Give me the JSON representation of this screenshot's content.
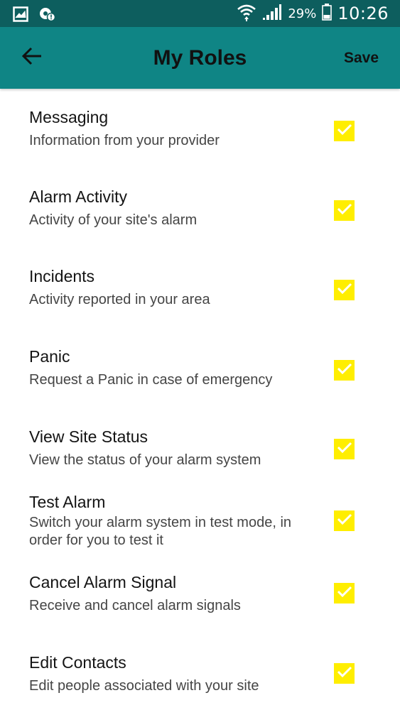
{
  "status_bar": {
    "left_icons": [
      "image-icon",
      "settings-alert-icon"
    ],
    "right_icons": [
      "wifi-icon",
      "cell-signal-icon",
      "battery-icon"
    ],
    "battery": "29%",
    "time": "10:26"
  },
  "app_bar": {
    "back_icon": "arrow-left-icon",
    "title": "My Roles",
    "save_label": "Save",
    "color": "#0f8585"
  },
  "roles": [
    {
      "title": "Messaging",
      "description": "Information from your provider",
      "checked": true
    },
    {
      "title": "Alarm Activity",
      "description": "Activity of your site's alarm",
      "checked": true
    },
    {
      "title": "Incidents",
      "description": "Activity reported in your area",
      "checked": true
    },
    {
      "title": "Panic",
      "description": "Request a Panic in case of emergency",
      "checked": true
    },
    {
      "title": "View Site Status",
      "description": "View the status of your alarm system",
      "checked": true
    },
    {
      "title": "Test Alarm",
      "description": "Switch your alarm system in test mode, in order for you to test it",
      "checked": true
    },
    {
      "title": "Cancel Alarm Signal",
      "description": "Receive and cancel alarm signals",
      "checked": true
    },
    {
      "title": "Edit Contacts",
      "description": "Edit people associated with your site",
      "checked": true
    }
  ],
  "colors": {
    "checkbox": "#ffee00",
    "status_bar": "#0d5e5e"
  }
}
